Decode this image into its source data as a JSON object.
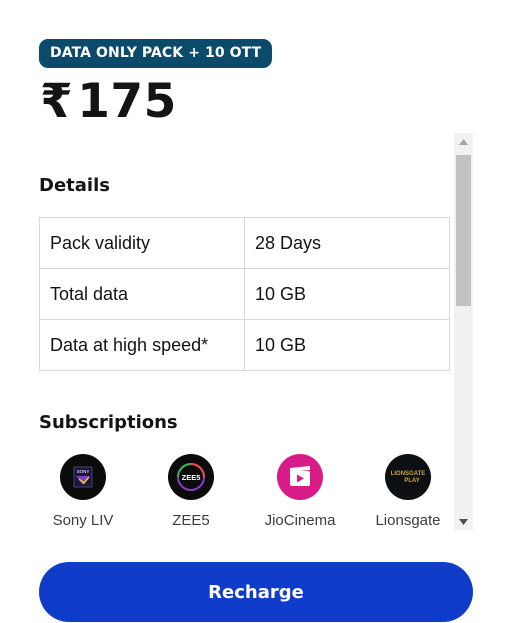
{
  "plan": {
    "badge": "DATA ONLY PACK + 10 OTT",
    "currency_symbol": "₹",
    "price": "175"
  },
  "details": {
    "title": "Details",
    "rows": [
      {
        "label": "Pack validity",
        "value": "28 Days"
      },
      {
        "label": "Total data",
        "value": "10 GB"
      },
      {
        "label": "Data at high speed*",
        "value": "10 GB"
      }
    ]
  },
  "subscriptions": {
    "title": "Subscriptions",
    "items": [
      {
        "name": "Sony LIV",
        "icon": "sony-liv-logo-icon",
        "logo_text": "SONY",
        "color": "#0b0b0b"
      },
      {
        "name": "ZEE5",
        "icon": "zee5-logo-icon",
        "logo_text": "ZEE5",
        "color": "#0b0b0b"
      },
      {
        "name": "JioCinema",
        "icon": "jiocinema-logo-icon",
        "logo_text": "",
        "color": "#d81b86"
      },
      {
        "name": "Lionsgate",
        "icon": "lionsgate-play-logo-icon",
        "logo_text": "LIONSGATE PLAY",
        "color": "#0d1012"
      }
    ]
  },
  "action": {
    "recharge_label": "Recharge"
  },
  "colors": {
    "badge_bg": "#0c4a6b",
    "button_bg": "#0f3cc9"
  }
}
